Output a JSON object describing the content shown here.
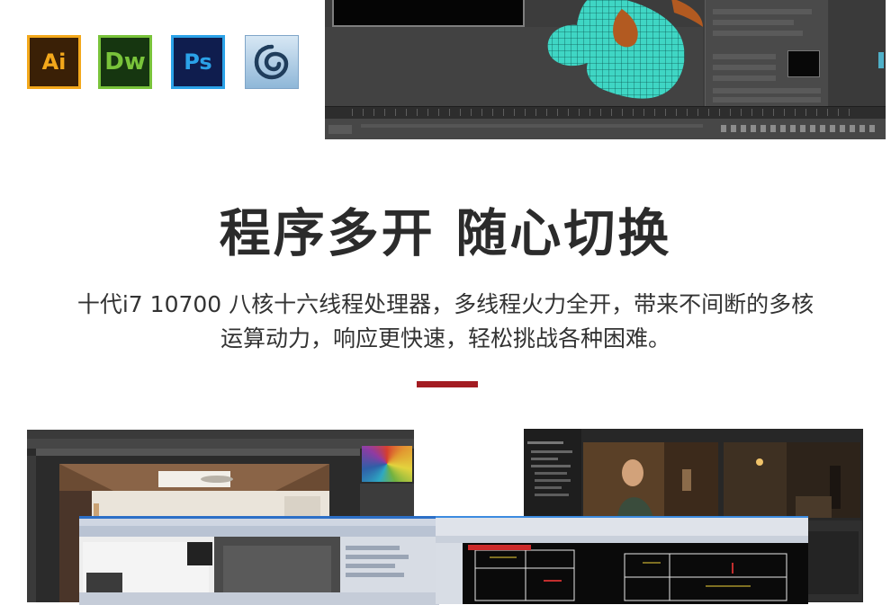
{
  "app_icons": [
    {
      "name": "Adobe Illustrator",
      "label": "Ai",
      "icon": "illustrator-icon",
      "border": "#f3a81b",
      "bg": "#3a2006"
    },
    {
      "name": "Adobe Dreamweaver",
      "label": "Dw",
      "icon": "dreamweaver-icon",
      "border": "#79c33a",
      "bg": "#163610"
    },
    {
      "name": "Adobe Photoshop",
      "label": "Ps",
      "icon": "photoshop-icon",
      "border": "#2ba2e8",
      "bg": "#0f1d4e"
    },
    {
      "name": "Autodesk 3ds Max",
      "label": "",
      "icon": "3ds-max-icon",
      "border": "#7fa5c8",
      "bg": "#bcd6eb"
    }
  ],
  "headline": "程序多开 随心切换",
  "description": {
    "line1": "十代i7 10700 八核十六线程处理器，多线程火力全开，带来不间断的多核",
    "line2": "运算动力，响应更快速，轻松挑战各种困难。"
  },
  "colors": {
    "accent_bar": "#a31c22",
    "headline_text": "#2b2b2b",
    "body_text": "#333333"
  },
  "screenshots": {
    "modeling": {
      "icon": "3d-modeling-screenshot"
    },
    "photoshop": {
      "icon": "photoshop-interior-screenshot"
    },
    "cad": {
      "icon": "cad-drawing-screenshot"
    },
    "video": {
      "icon": "video-editing-screenshot"
    }
  }
}
